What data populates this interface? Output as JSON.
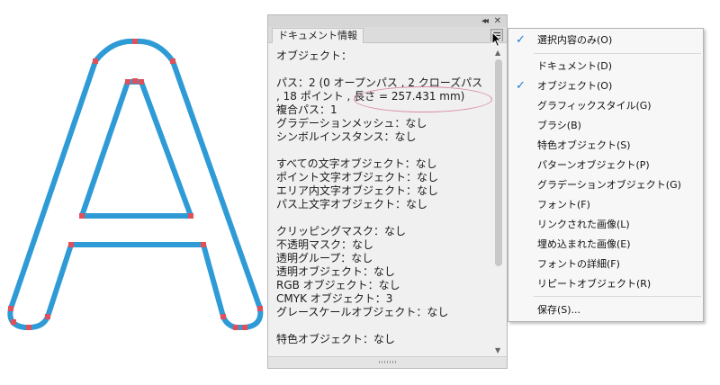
{
  "panel": {
    "tab_label": "ドキュメント情報",
    "collapse_glyph": "◂◂",
    "close_glyph": "✕",
    "info_lines": [
      "オブジェクト：",
      "",
      "パス：2 (0 オープンパス , 2 クローズパス",
      ", 18 ポイント , 長さ = 257.431 mm)",
      "複合パス：1",
      "グラデーションメッシュ：なし",
      "シンボルインスタンス：なし",
      "",
      "すべての文字オブジェクト：なし",
      "ポイント文字オブジェクト：なし",
      "エリア内文字オブジェクト：なし",
      "パス上文字オブジェクト：なし",
      "",
      "クリッピングマスク：なし",
      "不透明マスク：なし",
      "透明グループ：なし",
      "透明オブジェクト：なし",
      "RGB オブジェクト：なし",
      "CMYK オブジェクト：3",
      "グレースケールオブジェクト：なし",
      "",
      "特色オブジェクト：なし"
    ]
  },
  "menu": {
    "items": [
      {
        "label": "選択内容のみ(O)",
        "checked": true
      },
      {
        "label": "ドキュメント(D)",
        "checked": false
      },
      {
        "label": "オブジェクト(O)",
        "checked": true
      },
      {
        "label": "グラフィックスタイル(G)",
        "checked": false
      },
      {
        "label": "ブラシ(B)",
        "checked": false
      },
      {
        "label": "特色オブジェクト(S)",
        "checked": false
      },
      {
        "label": "パターンオブジェクト(P)",
        "checked": false
      },
      {
        "label": "グラデーションオブジェクト(G)",
        "checked": false
      },
      {
        "label": "フォント(F)",
        "checked": false
      },
      {
        "label": "リンクされた画像(L)",
        "checked": false
      },
      {
        "label": "埋め込まれた画像(E)",
        "checked": false
      },
      {
        "label": "フォントの詳細(F)",
        "checked": false
      },
      {
        "label": "リピートオブジェクト(R)",
        "checked": false
      },
      {
        "label": "保存(S)...",
        "checked": false
      }
    ],
    "check_glyph": "✓"
  },
  "colors": {
    "path_stroke": "#2e9bd6",
    "anchor_point": "#e0505a",
    "highlight": "#d98ca0",
    "check": "#1f7ad6"
  }
}
